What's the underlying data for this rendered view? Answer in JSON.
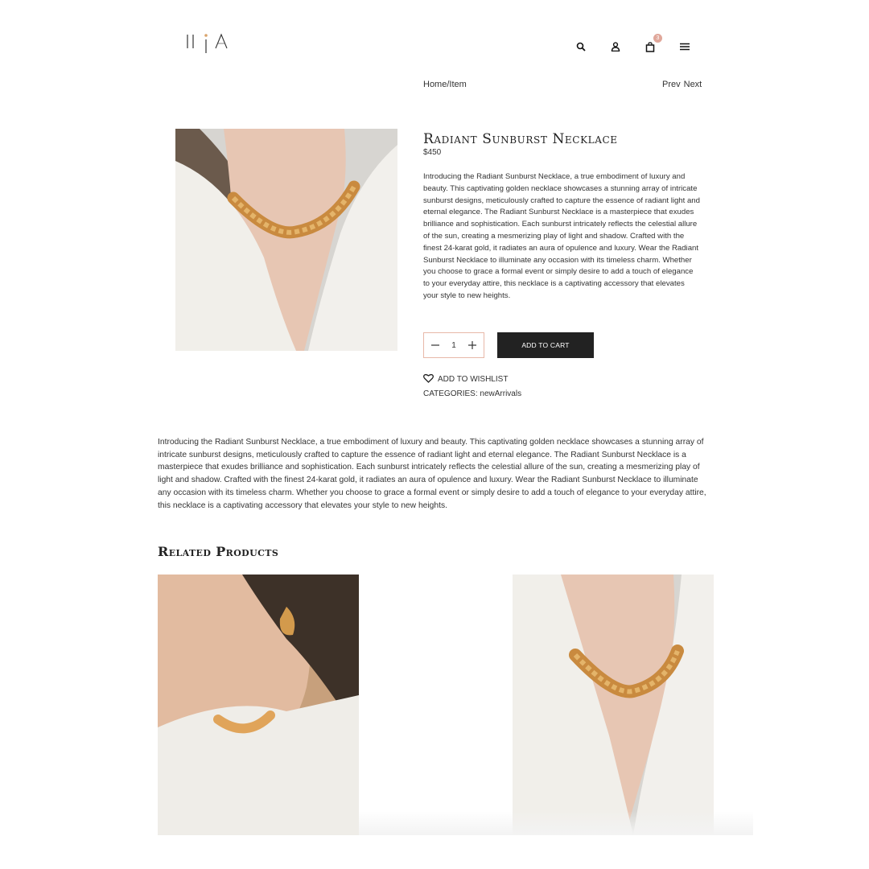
{
  "header": {
    "logo_icon": "hia-logo",
    "icons": [
      "search-icon",
      "user-icon",
      "bag-icon",
      "menu-icon"
    ],
    "cart_count": "3"
  },
  "breadcrumb": "Home/Item",
  "nav": {
    "prev": "Prev",
    "next": "Next"
  },
  "product": {
    "title": "Radiant Sunburst Necklace",
    "price": "$450",
    "description": "Introducing the Radiant Sunburst Necklace, a true embodiment of luxury and beauty. This captivating golden necklace showcases a stunning array of intricate sunburst designs, meticulously crafted to capture the essence of radiant light and eternal elegance. The Radiant Sunburst Necklace is a masterpiece that exudes brilliance and sophistication. Each sunburst intricately reflects the celestial allure of the sun, creating a mesmerizing play of light and shadow. Crafted with the finest 24-karat gold, it radiates an aura of opulence and luxury. Wear the Radiant Sunburst Necklace to illuminate any occasion with its timeless charm. Whether you choose to grace a formal event or simply desire to add a touch of elegance to your everyday attire, this necklace is a captivating accessory that elevates your style to new heights.",
    "quantity": "1",
    "add_to_cart_label": "ADD TO CART",
    "wishlist_label": "ADD TO WISHLIST",
    "categories_label": "CATEGORIES:",
    "categories_value": "newArrivals"
  },
  "related": {
    "title": "Related Products"
  },
  "colors": {
    "accent": "#e0a79a",
    "button_bg": "#222222",
    "qty_border": "#e8b8a8",
    "gold": "#c98a3f"
  }
}
